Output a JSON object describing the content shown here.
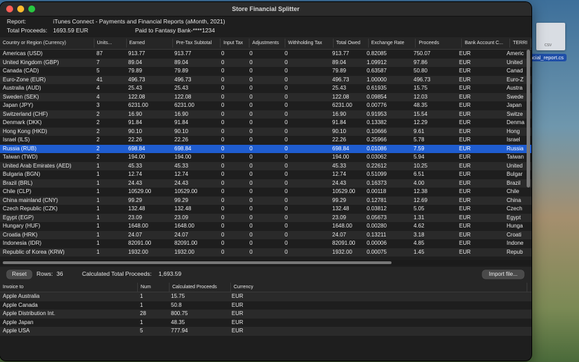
{
  "window": {
    "title": "Store Financial Splitter"
  },
  "info": {
    "report_label": "Report:",
    "report_value": "iTunes Connect - Payments and Financial Reports  (aMonth, 2021)",
    "total_label": "Total Proceeds:",
    "total_value": "1693.59 EUR",
    "paid_to": "Paid to Fantasy Bank-****1234"
  },
  "desktop": {
    "file_label": "ncial_report.cs",
    "file_tag": "CSV"
  },
  "table": {
    "columns": [
      "Country or Region (Currency)",
      "Units...",
      "Earned",
      "Pre-Tax Subtotal",
      "Input Tax",
      "Adjustments",
      "Withholding Tax",
      "Total Owed",
      "Exchange Rate",
      "Proceeds",
      "Bank Account C...",
      "TERRI"
    ],
    "rows": [
      [
        "Americas (USD)",
        "87",
        "913.77",
        "913.77",
        "0",
        "0",
        "0",
        "913.77",
        "0.82085",
        "750.07",
        "EUR",
        "Americ"
      ],
      [
        "United Kingdom (GBP)",
        "7",
        "89.04",
        "89.04",
        "0",
        "0",
        "0",
        "89.04",
        "1.09912",
        "97.86",
        "EUR",
        "United"
      ],
      [
        "Canada (CAD)",
        "5",
        "79.89",
        "79.89",
        "0",
        "0",
        "0",
        "79.89",
        "0.63587",
        "50.80",
        "EUR",
        "Canad"
      ],
      [
        "Euro-Zone (EUR)",
        "41",
        "496.73",
        "496.73",
        "0",
        "0",
        "0",
        "496.73",
        "1.00000",
        "496.73",
        "EUR",
        "Euro-Z"
      ],
      [
        "Australia (AUD)",
        "4",
        "25.43",
        "25.43",
        "0",
        "0",
        "0",
        "25.43",
        "0.61935",
        "15.75",
        "EUR",
        "Austra"
      ],
      [
        "Sweden (SEK)",
        "4",
        "122.08",
        "122.08",
        "0",
        "0",
        "0",
        "122.08",
        "0.09854",
        "12.03",
        "EUR",
        "Swede"
      ],
      [
        "Japan (JPY)",
        "3",
        "6231.00",
        "6231.00",
        "0",
        "0",
        "0",
        "6231.00",
        "0.00776",
        "48.35",
        "EUR",
        "Japan"
      ],
      [
        "Switzerland (CHF)",
        "2",
        "16.90",
        "16.90",
        "0",
        "0",
        "0",
        "16.90",
        "0.91953",
        "15.54",
        "EUR",
        "Switze"
      ],
      [
        "Denmark (DKK)",
        "2",
        "91.84",
        "91.84",
        "0",
        "0",
        "0",
        "91.84",
        "0.13382",
        "12.29",
        "EUR",
        "Denma"
      ],
      [
        "Hong Kong (HKD)",
        "2",
        "90.10",
        "90.10",
        "0",
        "0",
        "0",
        "90.10",
        "0.10666",
        "9.61",
        "EUR",
        "Hong"
      ],
      [
        "Israel (ILS)",
        "2",
        "22.26",
        "22.26",
        "0",
        "0",
        "0",
        "22.26",
        "0.25966",
        "5.78",
        "EUR",
        "Israel"
      ],
      [
        "Russia (RUB)",
        "2",
        "698.84",
        "698.84",
        "0",
        "0",
        "0",
        "698.84",
        "0.01086",
        "7.59",
        "EUR",
        "Russia"
      ],
      [
        "Taiwan (TWD)",
        "2",
        "194.00",
        "194.00",
        "0",
        "0",
        "0",
        "194.00",
        "0.03062",
        "5.94",
        "EUR",
        "Taiwan"
      ],
      [
        "United Arab Emirates (AED)",
        "1",
        "45.33",
        "45.33",
        "0",
        "0",
        "0",
        "45.33",
        "0.22612",
        "10.25",
        "EUR",
        "United"
      ],
      [
        "Bulgaria (BGN)",
        "1",
        "12.74",
        "12.74",
        "0",
        "0",
        "0",
        "12.74",
        "0.51099",
        "6.51",
        "EUR",
        "Bulgar"
      ],
      [
        "Brazil (BRL)",
        "1",
        "24.43",
        "24.43",
        "0",
        "0",
        "0",
        "24.43",
        "0.16373",
        "4.00",
        "EUR",
        "Brazil"
      ],
      [
        "Chile (CLP)",
        "1",
        "10529.00",
        "10529.00",
        "0",
        "0",
        "0",
        "10529.00",
        "0.00118",
        "12.38",
        "EUR",
        "Chile"
      ],
      [
        "China mainland (CNY)",
        "1",
        "99.29",
        "99.29",
        "0",
        "0",
        "0",
        "99.29",
        "0.12781",
        "12.69",
        "EUR",
        "China"
      ],
      [
        "Czech Republic (CZK)",
        "1",
        "132.48",
        "132.48",
        "0",
        "0",
        "0",
        "132.48",
        "0.03812",
        "5.05",
        "EUR",
        "Czech"
      ],
      [
        "Egypt (EGP)",
        "1",
        "23.09",
        "23.09",
        "0",
        "0",
        "0",
        "23.09",
        "0.05673",
        "1.31",
        "EUR",
        "Egypt"
      ],
      [
        "Hungary (HUF)",
        "1",
        "1648.00",
        "1648.00",
        "0",
        "0",
        "0",
        "1648.00",
        "0.00280",
        "4.62",
        "EUR",
        "Hunga"
      ],
      [
        "Croatia (HRK)",
        "1",
        "24.07",
        "24.07",
        "0",
        "0",
        "0",
        "24.07",
        "0.13211",
        "3.18",
        "EUR",
        "Croati"
      ],
      [
        "Indonesia (IDR)",
        "1",
        "82091.00",
        "82091.00",
        "0",
        "0",
        "0",
        "82091.00",
        "0.00006",
        "4.85",
        "EUR",
        "Indone"
      ],
      [
        "Republic of Korea (KRW)",
        "1",
        "1932.00",
        "1932.00",
        "0",
        "0",
        "0",
        "1932.00",
        "0.00075",
        "1.45",
        "EUR",
        "Repub"
      ]
    ]
  },
  "toolbar": {
    "reset_label": "Reset",
    "rows_label": "Rows:",
    "rows_value": "36",
    "calc_label": "Calculated Total Proceeds:",
    "calc_value": "1,693.59",
    "import_label": "Import file..."
  },
  "invoices": {
    "columns": [
      "Invoice to",
      "Num",
      "Calculated Proceeds",
      "Currency"
    ],
    "rows": [
      [
        "Apple Australia",
        "1",
        "15.75",
        "EUR"
      ],
      [
        "Apple Canada",
        "1",
        "50.8",
        "EUR"
      ],
      [
        "Apple Distribution Int.",
        "28",
        "800.75",
        "EUR"
      ],
      [
        "Apple Japan",
        "1",
        "48.35",
        "EUR"
      ],
      [
        "Apple USA",
        "5",
        "777.94",
        "EUR"
      ]
    ]
  }
}
